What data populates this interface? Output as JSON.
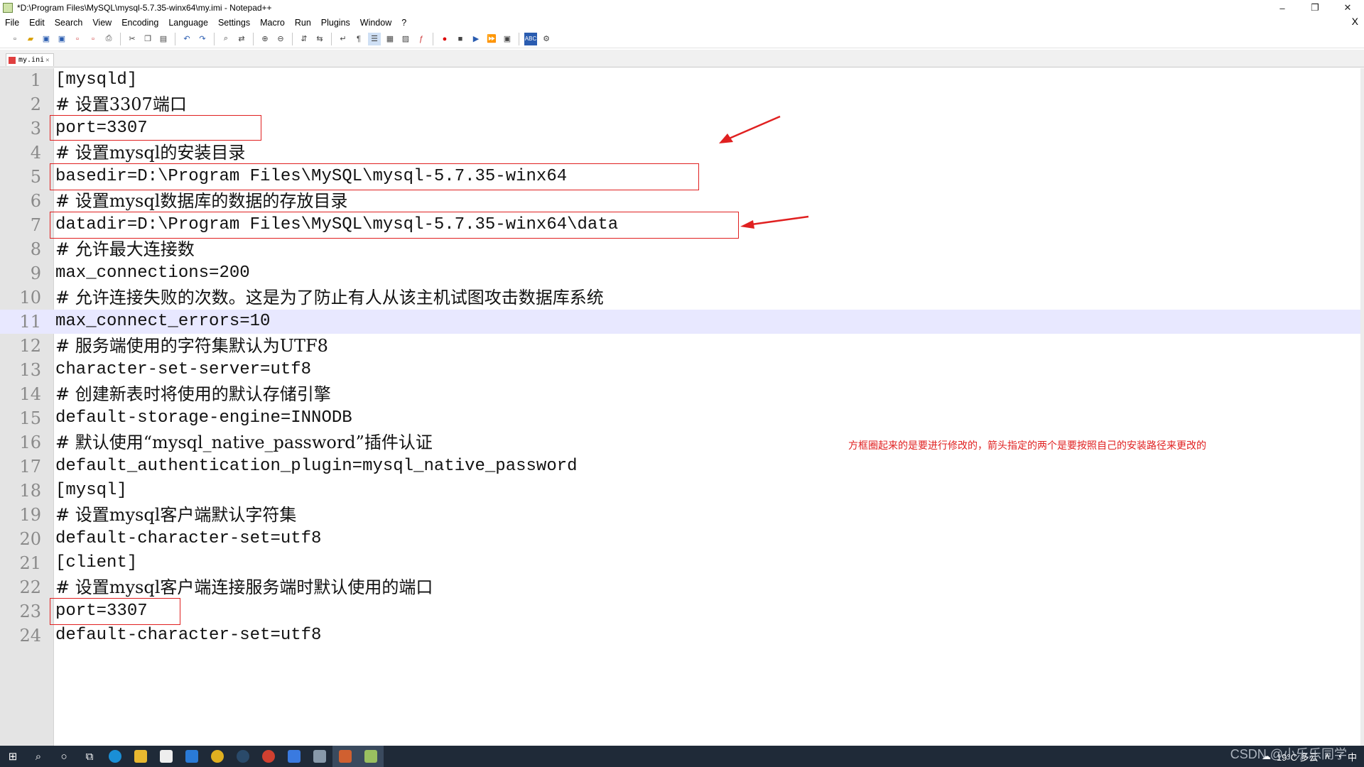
{
  "window": {
    "title": "*D:\\Program Files\\MySQL\\mysql-5.7.35-winx64\\my.imi - Notepad++",
    "controls": {
      "minimize": "–",
      "maximize": "❐",
      "close": "✕"
    }
  },
  "menu": {
    "items": [
      "File",
      "Edit",
      "Search",
      "View",
      "Encoding",
      "Language",
      "Settings",
      "Macro",
      "Run",
      "Plugins",
      "Window",
      "?"
    ],
    "close": "X"
  },
  "tab": {
    "label": "my.ini",
    "close": "✕"
  },
  "editor": {
    "current_line": 11,
    "lines": [
      {
        "num": "1",
        "text": "[mysqld]"
      },
      {
        "num": "2",
        "text": "# 设置3307端口"
      },
      {
        "num": "3",
        "text": "port=3307"
      },
      {
        "num": "4",
        "text": "# 设置mysql的安装目录"
      },
      {
        "num": "5",
        "text": "basedir=D:\\Program Files\\MySQL\\mysql-5.7.35-winx64"
      },
      {
        "num": "6",
        "text": "# 设置mysql数据库的数据的存放目录"
      },
      {
        "num": "7",
        "text": "datadir=D:\\Program Files\\MySQL\\mysql-5.7.35-winx64\\data"
      },
      {
        "num": "8",
        "text": "# 允许最大连接数"
      },
      {
        "num": "9",
        "text": "max_connections=200"
      },
      {
        "num": "10",
        "text": "# 允许连接失败的次数。这是为了防止有人从该主机试图攻击数据库系统"
      },
      {
        "num": "11",
        "text": "max_connect_errors=10"
      },
      {
        "num": "12",
        "text": "# 服务端使用的字符集默认为UTF8"
      },
      {
        "num": "13",
        "text": "character-set-server=utf8"
      },
      {
        "num": "14",
        "text": "# 创建新表时将使用的默认存储引擎"
      },
      {
        "num": "15",
        "text": "default-storage-engine=INNODB"
      },
      {
        "num": "16",
        "text": "# 默认使用“mysql_native_password”插件认证"
      },
      {
        "num": "17",
        "text": "default_authentication_plugin=mysql_native_password"
      },
      {
        "num": "18",
        "text": "[mysql]"
      },
      {
        "num": "19",
        "text": "# 设置mysql客户端默认字符集"
      },
      {
        "num": "20",
        "text": "default-character-set=utf8"
      },
      {
        "num": "21",
        "text": "[client]"
      },
      {
        "num": "22",
        "text": "# 设置mysql客户端连接服务端时默认使用的端口"
      },
      {
        "num": "23",
        "text": "port=3307"
      },
      {
        "num": "24",
        "text": "default-character-set=utf8"
      }
    ]
  },
  "annotation": {
    "note": "方框圈起来的是要进行修改的，箭头指定的两个是要按照自己的安装路径来更改的",
    "color": "#e02020"
  },
  "taskbar": {
    "weather": "19°C 多云",
    "tray_lang": "中",
    "watermark": "CSDN @小乐乐同学"
  },
  "colors": {
    "current_line": "#e8e8ff",
    "gutter": "#e4e4e4",
    "taskbar": "#1f2a38"
  }
}
